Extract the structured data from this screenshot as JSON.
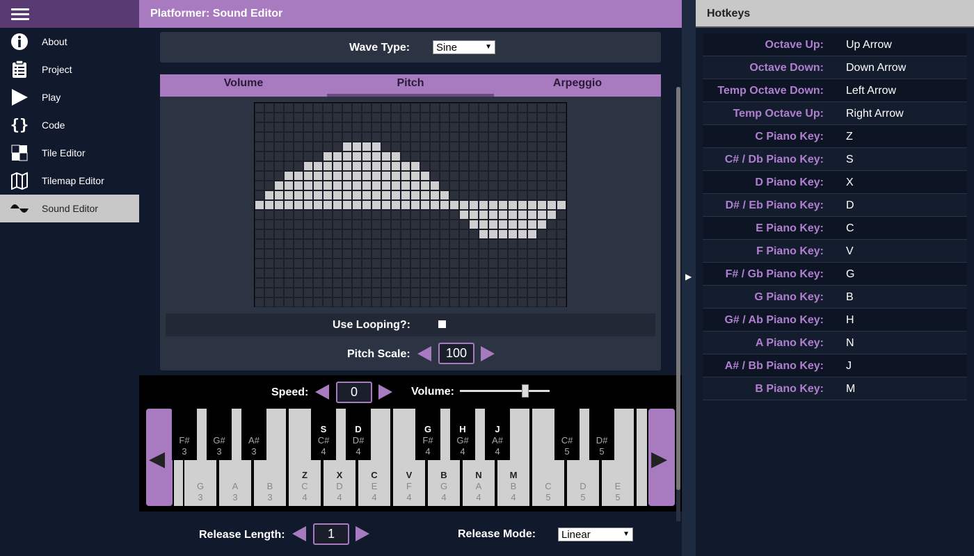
{
  "app": {
    "title": "Platformer: Sound Editor"
  },
  "sidebar": {
    "items": [
      {
        "label": "About",
        "icon": "info-icon"
      },
      {
        "label": "Project",
        "icon": "clipboard-icon"
      },
      {
        "label": "Play",
        "icon": "play-icon"
      },
      {
        "label": "Code",
        "icon": "code-braces-icon"
      },
      {
        "label": "Tile Editor",
        "icon": "tile-icon"
      },
      {
        "label": "Tilemap Editor",
        "icon": "map-icon"
      },
      {
        "label": "Sound Editor",
        "icon": "wave-icon",
        "active": true
      }
    ]
  },
  "editor": {
    "wave_type_label": "Wave Type:",
    "wave_type_value": "Sine",
    "tabs": [
      "Volume",
      "Pitch",
      "Arpeggio"
    ],
    "active_tab": "Pitch",
    "use_looping_label": "Use Looping?:",
    "pitch_scale_label": "Pitch Scale:",
    "pitch_scale_value": "100",
    "envelope": {
      "columns": 32,
      "rows": 21,
      "values": [
        0,
        1,
        2,
        3,
        3,
        4,
        4,
        5,
        5,
        6,
        6,
        6,
        6,
        5,
        5,
        4,
        4,
        3,
        2,
        1,
        0,
        -1,
        -2,
        -3,
        -3,
        -3,
        -3,
        -3,
        -3,
        -2,
        -1,
        0
      ]
    }
  },
  "piano": {
    "speed_label": "Speed:",
    "speed_value": "0",
    "volume_label": "Volume:",
    "volume_level": 0.73,
    "white_keys": [
      {
        "hotkey": "",
        "note": "G",
        "octave": "3"
      },
      {
        "hotkey": "",
        "note": "A",
        "octave": "3"
      },
      {
        "hotkey": "",
        "note": "B",
        "octave": "3"
      },
      {
        "hotkey": "Z",
        "note": "C",
        "octave": "4"
      },
      {
        "hotkey": "X",
        "note": "D",
        "octave": "4"
      },
      {
        "hotkey": "C",
        "note": "E",
        "octave": "4"
      },
      {
        "hotkey": "V",
        "note": "F",
        "octave": "4"
      },
      {
        "hotkey": "B",
        "note": "G",
        "octave": "4"
      },
      {
        "hotkey": "N",
        "note": "A",
        "octave": "4"
      },
      {
        "hotkey": "M",
        "note": "B",
        "octave": "4"
      },
      {
        "hotkey": "",
        "note": "C",
        "octave": "5"
      },
      {
        "hotkey": "",
        "note": "D",
        "octave": "5"
      },
      {
        "hotkey": "",
        "note": "E",
        "octave": "5"
      }
    ],
    "black_keys": [
      {
        "hotkey": "",
        "note": "F#",
        "octave": "3"
      },
      {
        "hotkey": "",
        "note": "G#",
        "octave": "3"
      },
      {
        "hotkey": "",
        "note": "A#",
        "octave": "3"
      },
      {
        "hotkey": "S",
        "note": "C#",
        "octave": "4"
      },
      {
        "hotkey": "D",
        "note": "D#",
        "octave": "4"
      },
      {
        "hotkey": "G",
        "note": "F#",
        "octave": "4"
      },
      {
        "hotkey": "H",
        "note": "G#",
        "octave": "4"
      },
      {
        "hotkey": "J",
        "note": "A#",
        "octave": "4"
      },
      {
        "hotkey": "",
        "note": "C#",
        "octave": "5"
      },
      {
        "hotkey": "",
        "note": "D#",
        "octave": "5"
      }
    ],
    "release_length_label": "Release Length:",
    "release_length_value": "1",
    "release_mode_label": "Release Mode:",
    "release_mode_value": "Linear"
  },
  "hotkeys": {
    "title": "Hotkeys",
    "rows": [
      {
        "label": "Octave Up:",
        "value": "Up Arrow"
      },
      {
        "label": "Octave Down:",
        "value": "Down Arrow"
      },
      {
        "label": "Temp Octave Down:",
        "value": "Left Arrow"
      },
      {
        "label": "Temp Octave Up:",
        "value": "Right Arrow"
      },
      {
        "label": "C Piano Key:",
        "value": "Z"
      },
      {
        "label": "C# / Db Piano Key:",
        "value": "S"
      },
      {
        "label": "D Piano Key:",
        "value": "X"
      },
      {
        "label": "D# / Eb Piano Key:",
        "value": "D"
      },
      {
        "label": "E Piano Key:",
        "value": "C"
      },
      {
        "label": "F Piano Key:",
        "value": "V"
      },
      {
        "label": "F# / Gb Piano Key:",
        "value": "G"
      },
      {
        "label": "G Piano Key:",
        "value": "B"
      },
      {
        "label": "G# / Ab Piano Key:",
        "value": "H"
      },
      {
        "label": "A Piano Key:",
        "value": "N"
      },
      {
        "label": "A# / Bb Piano Key:",
        "value": "J"
      },
      {
        "label": "B Piano Key:",
        "value": "M"
      }
    ]
  },
  "colors": {
    "accent": "#a87ac0",
    "background": "#111a2c",
    "panel": "#2c3444"
  }
}
